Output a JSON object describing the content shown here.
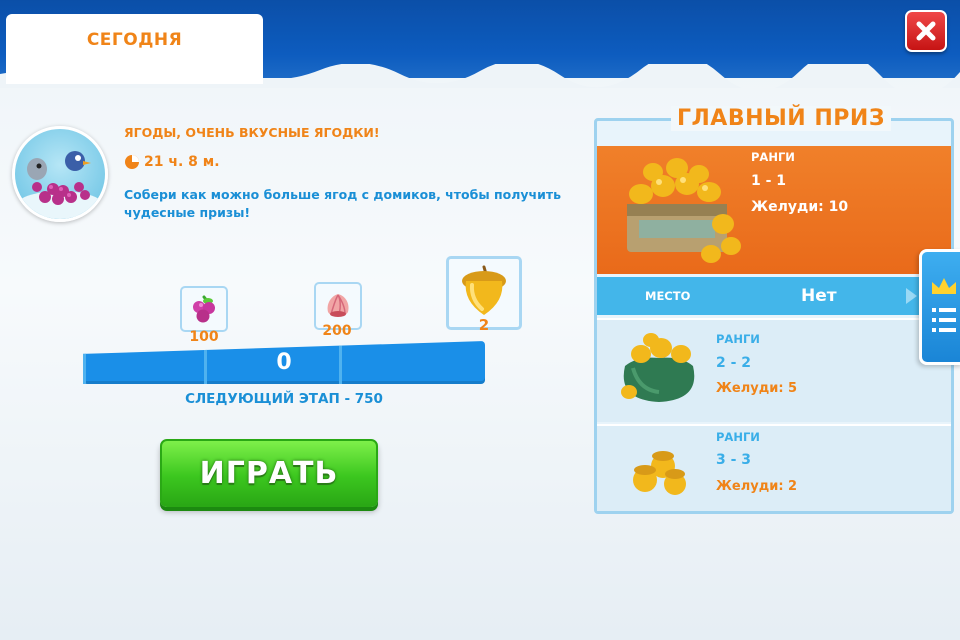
{
  "tabs": {
    "today_label": "СЕГОДНЯ"
  },
  "event": {
    "title": "ЯГОДЫ, ОЧЕНЬ ВКУСНЫЕ ЯГОДКИ!",
    "timer": "21 ч. 8 м.",
    "description": "Собери как можно больше ягод с домиков, чтобы получить чудесные призы!"
  },
  "milestones": [
    {
      "icon": "berry-icon",
      "value": "100"
    },
    {
      "icon": "shell-icon",
      "value": "200"
    },
    {
      "icon": "acorn-icon",
      "value": "2"
    }
  ],
  "progress": {
    "score": "0",
    "fraction": 0,
    "next_stage": "СЛЕДУЮЩИЙ ЭТАП - 750"
  },
  "play_label": "ИГРАТЬ",
  "grand_prize": {
    "title": "ГЛАВНЫЙ ПРИЗ",
    "ranks_label": "РАНГИ",
    "ranks": "1 - 1",
    "acorns": "Желуди: 10"
  },
  "place": {
    "label": "МЕСТО",
    "value": "Нет"
  },
  "tiers": [
    {
      "ranks_label": "РАНГИ",
      "ranks": "2 - 2",
      "acorns": "Желуди: 5"
    },
    {
      "ranks_label": "РАНГИ",
      "ranks": "3 - 3",
      "acorns": "Желуди: 2"
    }
  ],
  "colors": {
    "accent_orange": "#f08418",
    "text_blue": "#1a8fd6",
    "play_green": "#3cc71f",
    "banner_blue": "#0d5cbf"
  }
}
